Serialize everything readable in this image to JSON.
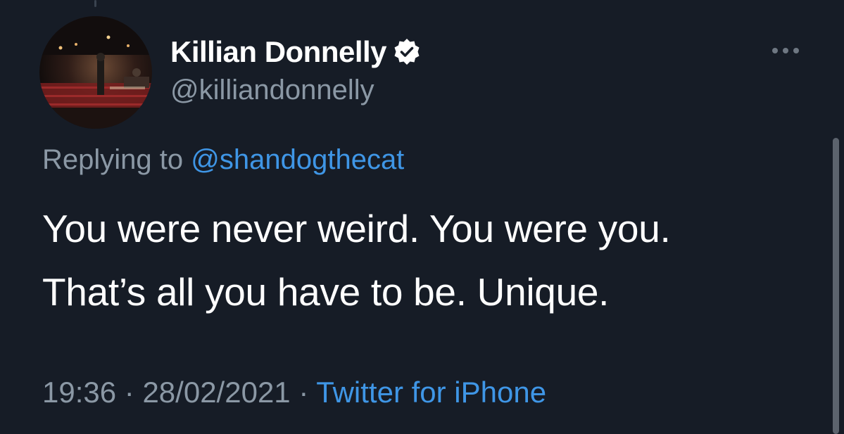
{
  "tweet": {
    "display_name": "Killian Donnelly",
    "handle": "@killiandonnelly",
    "replying_prefix": "Replying to",
    "replying_to": "@shandogthecat",
    "text_line_1": "You were never weird. You were you.",
    "text_line_2": "That’s all you have to be. Unique.",
    "time": "19:36",
    "separator": "·",
    "date": "28/02/2021",
    "source": "Twitter for iPhone"
  },
  "icons": {
    "verified": "verified-badge-icon",
    "more": "more-options-icon"
  },
  "colors": {
    "background": "#161c26",
    "primary_text": "#ffffff",
    "secondary_text": "#8b98a5",
    "link": "#3f96e6"
  }
}
